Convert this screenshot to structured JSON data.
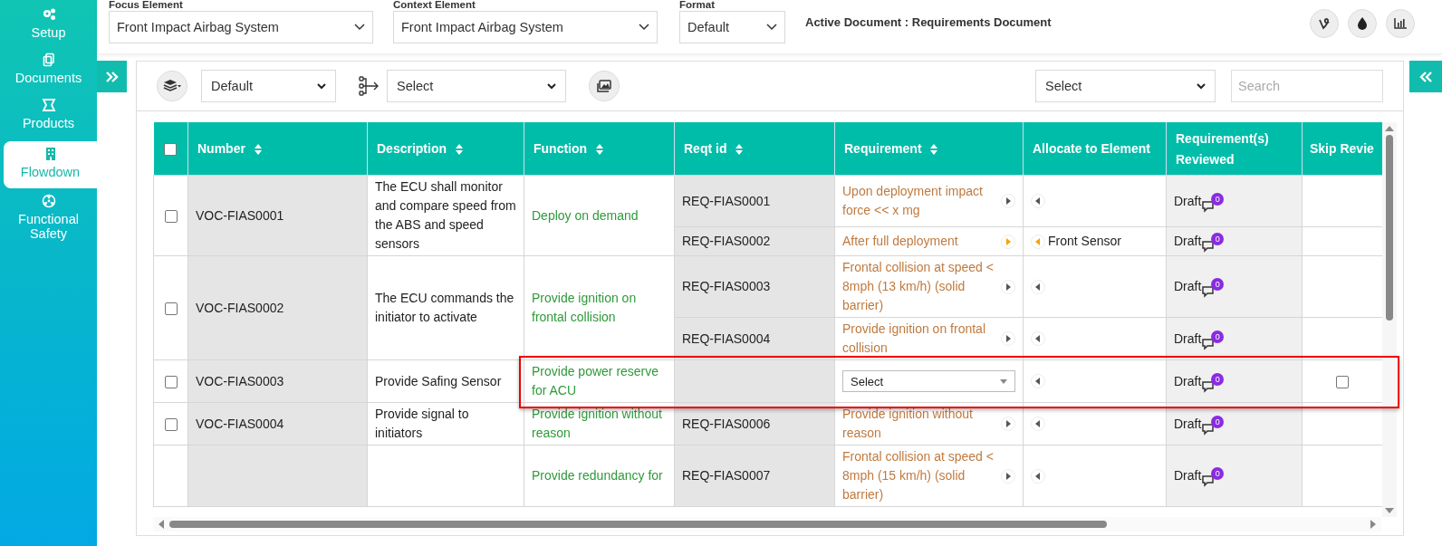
{
  "sidebar": {
    "items": [
      {
        "label": "Setup",
        "selected": false
      },
      {
        "label": "Documents",
        "selected": false
      },
      {
        "label": "Products",
        "selected": false
      },
      {
        "label": "Flowdown",
        "selected": true
      },
      {
        "label": "Functional Safety",
        "selected": false
      }
    ]
  },
  "header": {
    "fields": [
      {
        "label": "Focus Element",
        "value": "Front Impact Airbag System"
      },
      {
        "label": "Context Element",
        "value": "Front Impact Airbag System"
      },
      {
        "label": "Format",
        "value": "Default"
      }
    ],
    "active_document": "Active Document : Requirements Document"
  },
  "toolbar": {
    "view_select": "Default",
    "flow_select": "Select",
    "filter_select": "Select",
    "search": {
      "placeholder": "Search"
    }
  },
  "table": {
    "select_all": {
      "checked": false
    },
    "columns": [
      {
        "label": "Number",
        "sortable": true
      },
      {
        "label": "Description",
        "sortable": true
      },
      {
        "label": "Function",
        "sortable": true
      },
      {
        "label": "Reqt id",
        "sortable": true
      },
      {
        "label": "Requirement",
        "sortable": true
      },
      {
        "label": "Allocate to Element",
        "sortable": false
      },
      {
        "label": "Requirement(s) Reviewed",
        "sortable": false
      },
      {
        "label": "Skip Revie",
        "sortable": false
      }
    ],
    "groups": [
      {
        "checked": false,
        "number": "VOC-FIAS0001",
        "description": "The ECU shall monitor and compare speed from the ABS and speed sensors",
        "function": "Deploy on demand",
        "reqs": [
          {
            "kind": "text",
            "id": "REQ-FIAS0001",
            "requirement": "Upon deployment impact force << x mg",
            "linked": false,
            "status": "Draft",
            "comments": "0"
          },
          {
            "kind": "text",
            "id": "REQ-FIAS0002",
            "requirement": "After full deployment",
            "linked": true,
            "allocation": "Front Sensor",
            "status": "Draft",
            "comments": "0"
          }
        ]
      },
      {
        "checked": false,
        "number": "VOC-FIAS0002",
        "description": "The ECU commands the initiator to activate",
        "function": "Provide ignition on frontal collision",
        "reqs": [
          {
            "kind": "text",
            "id": "REQ-FIAS0003",
            "requirement": "Frontal collision at speed < 8mph (13 km/h) (solid barrier)",
            "linked": false,
            "status": "Draft",
            "comments": "0"
          },
          {
            "kind": "text",
            "id": "REQ-FIAS0004",
            "requirement": "Provide ignition on frontal collision",
            "linked": false,
            "status": "Draft",
            "comments": "0"
          }
        ]
      },
      {
        "checked": false,
        "number": "VOC-FIAS0003",
        "description": "Provide Safing Sensor",
        "function": "Provide power reserve for ACU",
        "reqs": [
          {
            "kind": "select",
            "requirement": "Select",
            "linked": false,
            "status": "Draft",
            "comments": "0",
            "skip_review": {
              "checked": false
            }
          }
        ]
      },
      {
        "checked": false,
        "number": "VOC-FIAS0004",
        "description": "Provide signal to initiators",
        "function": "Provide ignition without reason",
        "reqs": [
          {
            "kind": "text",
            "id": "REQ-FIAS0006",
            "requirement": "Provide ignition without reason",
            "linked": false,
            "status": "Draft",
            "comments": "0"
          }
        ]
      },
      {
        "function": "Provide redundancy for",
        "reqs": [
          {
            "kind": "text",
            "id": "REQ-FIAS0007",
            "requirement": "Frontal collision at speed < 8mph (15 km/h) (solid barrier)",
            "linked": false,
            "status": "Draft",
            "comments": "0"
          }
        ]
      }
    ]
  }
}
